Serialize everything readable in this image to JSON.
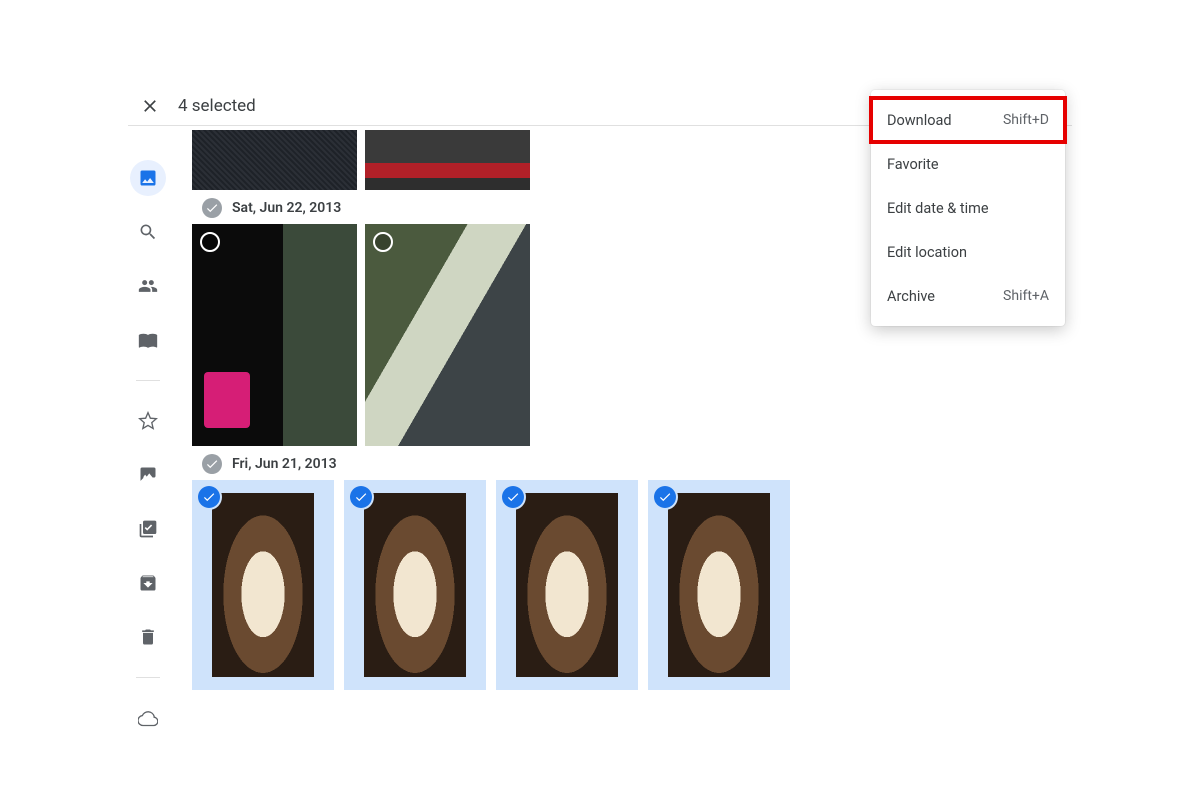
{
  "header": {
    "selection_label": "4 selected"
  },
  "rail": {
    "items": [
      "photos",
      "search",
      "sharing",
      "library",
      "favorites",
      "albums",
      "utilities",
      "archive",
      "trash",
      "storage"
    ]
  },
  "groups": [
    {
      "date_label": "Sat, Jun 22, 2013"
    },
    {
      "date_label": "Fri, Jun 21, 2013"
    }
  ],
  "menu": {
    "download_label": "Download",
    "download_shortcut": "Shift+D",
    "favorite_label": "Favorite",
    "edit_date_label": "Edit date & time",
    "edit_location_label": "Edit location",
    "archive_label": "Archive",
    "archive_shortcut": "Shift+A"
  }
}
